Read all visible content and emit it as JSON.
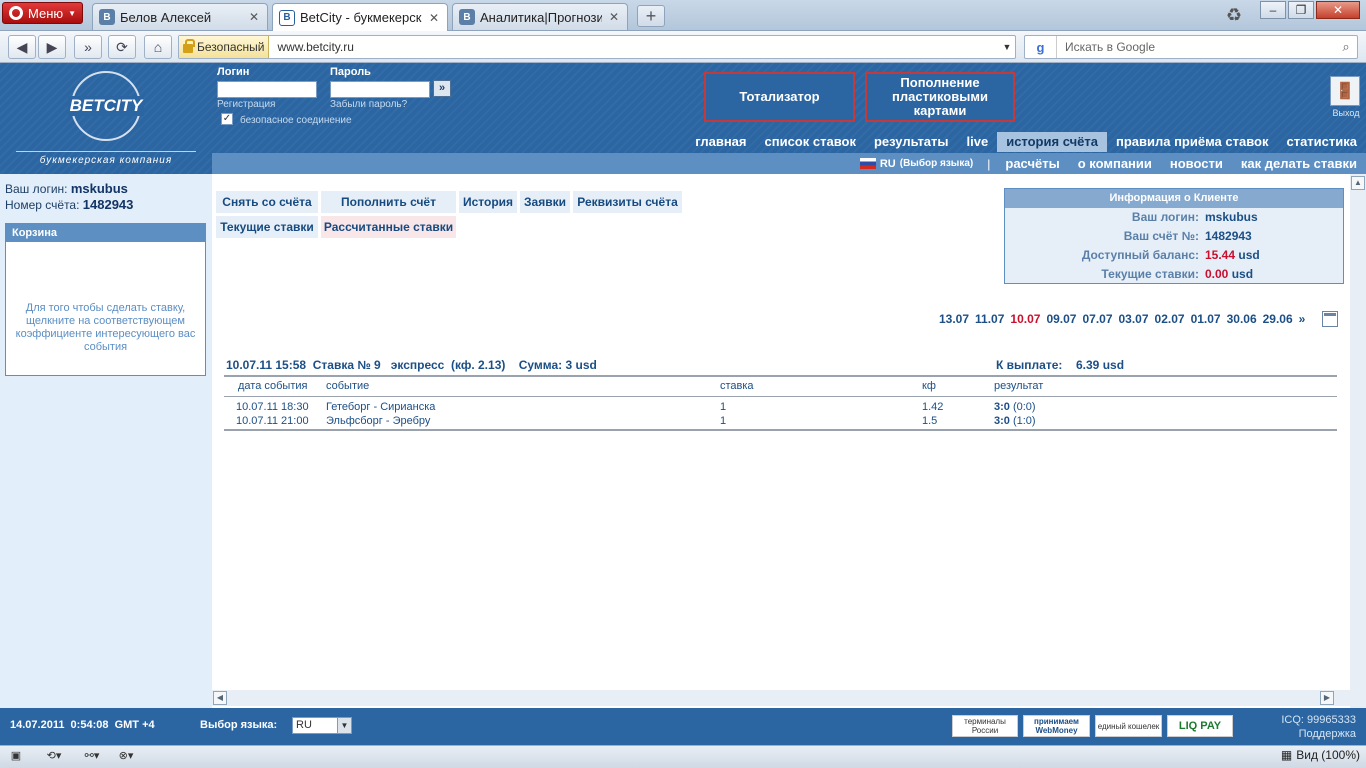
{
  "browser": {
    "menu_label": "Меню",
    "tabs": [
      {
        "label": "Белов Алексей",
        "favicon": "vk-icon"
      },
      {
        "label": "BetCity - букмекерска...",
        "favicon": "betcity-icon",
        "active": true
      },
      {
        "label": "Аналитика|Прогнози...",
        "favicon": "vk-icon"
      }
    ],
    "new_tab": "+",
    "secure_label": "Безопасный",
    "url": "www.betcity.ru",
    "search_placeholder": "Искать в Google",
    "zoom": "Вид (100%)"
  },
  "header": {
    "logo_text": "BETCITY",
    "logo_sub": "букмекерская компания",
    "login_label": "Логин",
    "password_label": "Пароль",
    "register_link": "Регистрация",
    "forgot_link": "Забыли пароль?",
    "go_button": "»",
    "secure_conn": "безопасное соединение",
    "totalizator": "Тотализатор",
    "topup_cards": "Пополнение пластиковыми картами",
    "exit_label": "Выход"
  },
  "nav_main": [
    "главная",
    "список ставок",
    "результаты",
    "live",
    "история счёта",
    "правила приёма ставок",
    "статистика"
  ],
  "nav_active": "история счёта",
  "nav_sub": {
    "lang": "RU",
    "lang_choice": "(Выбор языка)",
    "separator": "|",
    "items": [
      "расчёты",
      "о компании",
      "новости",
      "как делать ставки"
    ]
  },
  "sidebar": {
    "login_label": "Ваш логин:",
    "login_value": "mskubus",
    "account_label": "Номер счёта:",
    "account_value": "1482943",
    "basket_title": "Корзина",
    "basket_text": "Для того чтобы сделать ставку, щелкните на соответствующем коэффициенте интересующего вас события"
  },
  "account_buttons": {
    "withdraw": "Снять со счёта",
    "deposit": "Пополнить счёт",
    "history": "История",
    "requests": "Заявки",
    "requisites": "Реквизиты счёта",
    "current_bets": "Текущие ставки",
    "settled_bets": "Рассчитанные ставки"
  },
  "client_info": {
    "title": "Информация о Клиенте",
    "login_label": "Ваш логин:",
    "login_value": "mskubus",
    "account_label": "Ваш счёт №:",
    "account_value": "1482943",
    "balance_label": "Доступный баланс:",
    "balance_value": "15.44",
    "currency": "usd",
    "current_label": "Текущие ставки:",
    "current_value": "0.00"
  },
  "dates": [
    "13.07",
    "11.07",
    "10.07",
    "09.07",
    "07.07",
    "03.07",
    "02.07",
    "01.07",
    "30.06",
    "29.06",
    "»"
  ],
  "dates_current": "10.07",
  "bet": {
    "header": "10.07.11 15:58  Ставка № 9   экспресс  (кф. 2.13)    Сумма: 3 usd",
    "payout_label": "К выплате:",
    "payout_value": "6.39 usd",
    "columns": [
      "дата события",
      "событие",
      "ставка",
      "кф",
      "результат"
    ],
    "rows": [
      {
        "date": "10.07.11 18:30",
        "event": "Гетеборг - Сирианска",
        "bet": "1",
        "coef": "1.42",
        "score": "3:0",
        "half": "(0:0)"
      },
      {
        "date": "10.07.11 21:00",
        "event": "Эльфсборг - Эребру",
        "bet": "1",
        "coef": "1.5",
        "score": "3:0",
        "half": "(1:0)"
      }
    ]
  },
  "footer": {
    "datetime": "14.07.2011  0:54:08  GMT +4",
    "lang_label": "Выбор языка:",
    "lang_value": "RU",
    "pay1": "терминалы России",
    "pay2": "принимаем WebMoney",
    "pay3": "единый кошелек",
    "pay4": "LIQ PAY",
    "icq": "ICQ: 99965333",
    "support": "Поддержка"
  },
  "colors": {
    "brand_blue": "#2b66a3",
    "accent_red": "#c8102e"
  }
}
